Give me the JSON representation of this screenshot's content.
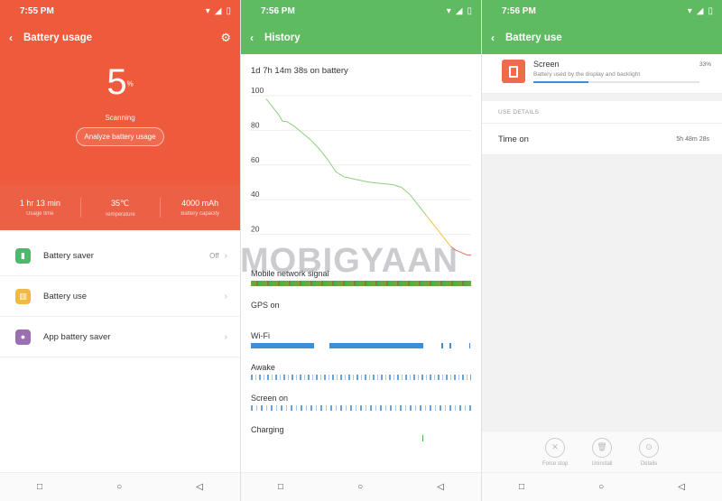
{
  "panel1": {
    "status_time": "7:55 PM",
    "title": "Battery usage",
    "percent": "5",
    "percent_unit": "%",
    "scanning": "Scanning",
    "analyze_button": "Analyze battery usage",
    "stats": [
      {
        "value": "1 hr 13 min",
        "label": "Usage time"
      },
      {
        "value": "35℃",
        "label": "Temperature"
      },
      {
        "value": "4000 mAh",
        "label": "Battery capacity"
      }
    ],
    "menu": [
      {
        "label": "Battery saver",
        "value": "Off",
        "icon": "battery-saver-icon",
        "color": "#4cba6c"
      },
      {
        "label": "Battery use",
        "value": "",
        "icon": "bar-chart-icon",
        "color": "#f0b845"
      },
      {
        "label": "App battery saver",
        "value": "",
        "icon": "shield-icon",
        "color": "#9c6fb3"
      }
    ],
    "accent": "#ee5a3c"
  },
  "panel2": {
    "status_time": "7:56 PM",
    "title": "History",
    "duration": "1d 7h 14m 38s on battery",
    "y_ticks": [
      "100",
      "80",
      "60",
      "40",
      "20"
    ],
    "signals": [
      {
        "label": "Mobile network signal"
      },
      {
        "label": "GPS on"
      },
      {
        "label": "Wi-Fi"
      },
      {
        "label": "Awake"
      },
      {
        "label": "Screen on"
      },
      {
        "label": "Charging"
      }
    ],
    "accent": "#5fbb62"
  },
  "panel3": {
    "status_time": "7:56 PM",
    "title": "Battery use",
    "item_title": "Screen",
    "item_subtitle": "Battery used by the display and backlight",
    "item_percent": "33%",
    "item_fraction": 0.33,
    "section_title": "USE DETAILS",
    "detail_key": "Time on",
    "detail_value": "5h 48m 28s",
    "actions": [
      {
        "label": "Force stop",
        "icon": "close-icon"
      },
      {
        "label": "Uninstall",
        "icon": "trash-icon"
      },
      {
        "label": "Details",
        "icon": "info-icon"
      }
    ]
  },
  "watermark": "MOBIGYAAN",
  "chart_data": {
    "type": "line",
    "title": "",
    "xlabel": "",
    "ylabel": "",
    "ylim": [
      0,
      100
    ],
    "y_ticks": [
      100,
      80,
      60,
      40,
      20
    ],
    "series": [
      {
        "x": [
          0,
          2,
          4,
          6,
          8,
          10,
          14,
          18,
          22,
          26,
          30,
          34,
          38,
          42,
          46,
          50,
          54,
          58,
          62,
          66,
          70,
          74,
          78,
          82,
          86,
          88,
          90,
          92,
          94,
          96,
          98,
          100
        ],
        "y": [
          95,
          92,
          89,
          86,
          82,
          82,
          79,
          75,
          71,
          66,
          60,
          53,
          50,
          49,
          48,
          47,
          46.5,
          46,
          45.5,
          44,
          40,
          34,
          28,
          22,
          16,
          13,
          10,
          8,
          7,
          6,
          5,
          5
        ]
      }
    ]
  }
}
